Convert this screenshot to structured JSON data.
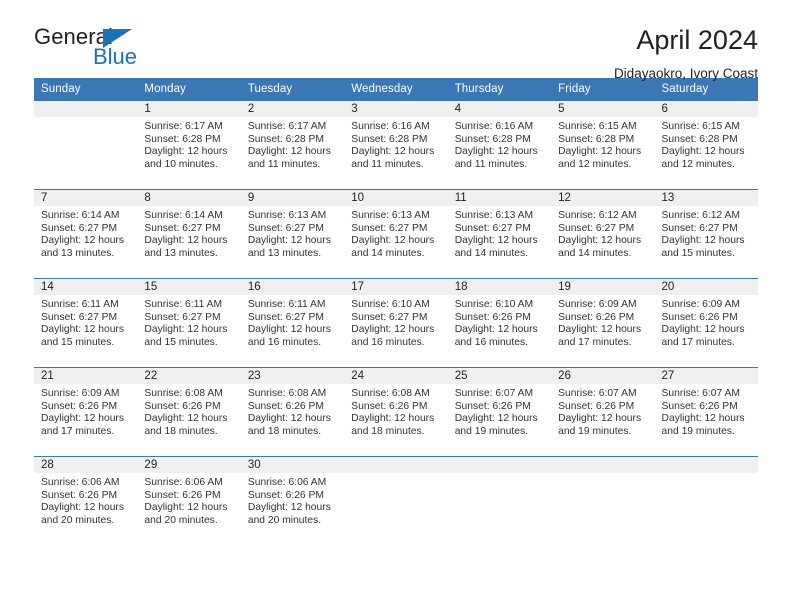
{
  "brand": {
    "name_part1": "General",
    "name_part2": "Blue",
    "accent_color": "#1b72b8"
  },
  "header": {
    "title": "April 2024",
    "location": "Didayaokro, Ivory Coast"
  },
  "theme": {
    "header_row_color": "#3b77b5",
    "daynum_band_color": "#f0f0f0",
    "text_color": "#231f20"
  },
  "weekdays": [
    "Sunday",
    "Monday",
    "Tuesday",
    "Wednesday",
    "Thursday",
    "Friday",
    "Saturday"
  ],
  "weeks": [
    [
      {
        "day": "",
        "sunrise": "",
        "sunset": "",
        "daylight_line1": "",
        "daylight_line2": "",
        "empty": true
      },
      {
        "day": "1",
        "sunrise": "Sunrise: 6:17 AM",
        "sunset": "Sunset: 6:28 PM",
        "daylight_line1": "Daylight: 12 hours",
        "daylight_line2": "and 10 minutes."
      },
      {
        "day": "2",
        "sunrise": "Sunrise: 6:17 AM",
        "sunset": "Sunset: 6:28 PM",
        "daylight_line1": "Daylight: 12 hours",
        "daylight_line2": "and 11 minutes."
      },
      {
        "day": "3",
        "sunrise": "Sunrise: 6:16 AM",
        "sunset": "Sunset: 6:28 PM",
        "daylight_line1": "Daylight: 12 hours",
        "daylight_line2": "and 11 minutes."
      },
      {
        "day": "4",
        "sunrise": "Sunrise: 6:16 AM",
        "sunset": "Sunset: 6:28 PM",
        "daylight_line1": "Daylight: 12 hours",
        "daylight_line2": "and 11 minutes."
      },
      {
        "day": "5",
        "sunrise": "Sunrise: 6:15 AM",
        "sunset": "Sunset: 6:28 PM",
        "daylight_line1": "Daylight: 12 hours",
        "daylight_line2": "and 12 minutes."
      },
      {
        "day": "6",
        "sunrise": "Sunrise: 6:15 AM",
        "sunset": "Sunset: 6:28 PM",
        "daylight_line1": "Daylight: 12 hours",
        "daylight_line2": "and 12 minutes."
      }
    ],
    [
      {
        "day": "7",
        "sunrise": "Sunrise: 6:14 AM",
        "sunset": "Sunset: 6:27 PM",
        "daylight_line1": "Daylight: 12 hours",
        "daylight_line2": "and 13 minutes."
      },
      {
        "day": "8",
        "sunrise": "Sunrise: 6:14 AM",
        "sunset": "Sunset: 6:27 PM",
        "daylight_line1": "Daylight: 12 hours",
        "daylight_line2": "and 13 minutes."
      },
      {
        "day": "9",
        "sunrise": "Sunrise: 6:13 AM",
        "sunset": "Sunset: 6:27 PM",
        "daylight_line1": "Daylight: 12 hours",
        "daylight_line2": "and 13 minutes."
      },
      {
        "day": "10",
        "sunrise": "Sunrise: 6:13 AM",
        "sunset": "Sunset: 6:27 PM",
        "daylight_line1": "Daylight: 12 hours",
        "daylight_line2": "and 14 minutes."
      },
      {
        "day": "11",
        "sunrise": "Sunrise: 6:13 AM",
        "sunset": "Sunset: 6:27 PM",
        "daylight_line1": "Daylight: 12 hours",
        "daylight_line2": "and 14 minutes."
      },
      {
        "day": "12",
        "sunrise": "Sunrise: 6:12 AM",
        "sunset": "Sunset: 6:27 PM",
        "daylight_line1": "Daylight: 12 hours",
        "daylight_line2": "and 14 minutes."
      },
      {
        "day": "13",
        "sunrise": "Sunrise: 6:12 AM",
        "sunset": "Sunset: 6:27 PM",
        "daylight_line1": "Daylight: 12 hours",
        "daylight_line2": "and 15 minutes."
      }
    ],
    [
      {
        "day": "14",
        "sunrise": "Sunrise: 6:11 AM",
        "sunset": "Sunset: 6:27 PM",
        "daylight_line1": "Daylight: 12 hours",
        "daylight_line2": "and 15 minutes."
      },
      {
        "day": "15",
        "sunrise": "Sunrise: 6:11 AM",
        "sunset": "Sunset: 6:27 PM",
        "daylight_line1": "Daylight: 12 hours",
        "daylight_line2": "and 15 minutes."
      },
      {
        "day": "16",
        "sunrise": "Sunrise: 6:11 AM",
        "sunset": "Sunset: 6:27 PM",
        "daylight_line1": "Daylight: 12 hours",
        "daylight_line2": "and 16 minutes."
      },
      {
        "day": "17",
        "sunrise": "Sunrise: 6:10 AM",
        "sunset": "Sunset: 6:27 PM",
        "daylight_line1": "Daylight: 12 hours",
        "daylight_line2": "and 16 minutes."
      },
      {
        "day": "18",
        "sunrise": "Sunrise: 6:10 AM",
        "sunset": "Sunset: 6:26 PM",
        "daylight_line1": "Daylight: 12 hours",
        "daylight_line2": "and 16 minutes."
      },
      {
        "day": "19",
        "sunrise": "Sunrise: 6:09 AM",
        "sunset": "Sunset: 6:26 PM",
        "daylight_line1": "Daylight: 12 hours",
        "daylight_line2": "and 17 minutes."
      },
      {
        "day": "20",
        "sunrise": "Sunrise: 6:09 AM",
        "sunset": "Sunset: 6:26 PM",
        "daylight_line1": "Daylight: 12 hours",
        "daylight_line2": "and 17 minutes."
      }
    ],
    [
      {
        "day": "21",
        "sunrise": "Sunrise: 6:09 AM",
        "sunset": "Sunset: 6:26 PM",
        "daylight_line1": "Daylight: 12 hours",
        "daylight_line2": "and 17 minutes."
      },
      {
        "day": "22",
        "sunrise": "Sunrise: 6:08 AM",
        "sunset": "Sunset: 6:26 PM",
        "daylight_line1": "Daylight: 12 hours",
        "daylight_line2": "and 18 minutes."
      },
      {
        "day": "23",
        "sunrise": "Sunrise: 6:08 AM",
        "sunset": "Sunset: 6:26 PM",
        "daylight_line1": "Daylight: 12 hours",
        "daylight_line2": "and 18 minutes."
      },
      {
        "day": "24",
        "sunrise": "Sunrise: 6:08 AM",
        "sunset": "Sunset: 6:26 PM",
        "daylight_line1": "Daylight: 12 hours",
        "daylight_line2": "and 18 minutes."
      },
      {
        "day": "25",
        "sunrise": "Sunrise: 6:07 AM",
        "sunset": "Sunset: 6:26 PM",
        "daylight_line1": "Daylight: 12 hours",
        "daylight_line2": "and 19 minutes."
      },
      {
        "day": "26",
        "sunrise": "Sunrise: 6:07 AM",
        "sunset": "Sunset: 6:26 PM",
        "daylight_line1": "Daylight: 12 hours",
        "daylight_line2": "and 19 minutes."
      },
      {
        "day": "27",
        "sunrise": "Sunrise: 6:07 AM",
        "sunset": "Sunset: 6:26 PM",
        "daylight_line1": "Daylight: 12 hours",
        "daylight_line2": "and 19 minutes."
      }
    ],
    [
      {
        "day": "28",
        "sunrise": "Sunrise: 6:06 AM",
        "sunset": "Sunset: 6:26 PM",
        "daylight_line1": "Daylight: 12 hours",
        "daylight_line2": "and 20 minutes."
      },
      {
        "day": "29",
        "sunrise": "Sunrise: 6:06 AM",
        "sunset": "Sunset: 6:26 PM",
        "daylight_line1": "Daylight: 12 hours",
        "daylight_line2": "and 20 minutes."
      },
      {
        "day": "30",
        "sunrise": "Sunrise: 6:06 AM",
        "sunset": "Sunset: 6:26 PM",
        "daylight_line1": "Daylight: 12 hours",
        "daylight_line2": "and 20 minutes."
      },
      {
        "day": "",
        "sunrise": "",
        "sunset": "",
        "daylight_line1": "",
        "daylight_line2": "",
        "empty": true
      },
      {
        "day": "",
        "sunrise": "",
        "sunset": "",
        "daylight_line1": "",
        "daylight_line2": "",
        "empty": true
      },
      {
        "day": "",
        "sunrise": "",
        "sunset": "",
        "daylight_line1": "",
        "daylight_line2": "",
        "empty": true
      },
      {
        "day": "",
        "sunrise": "",
        "sunset": "",
        "daylight_line1": "",
        "daylight_line2": "",
        "empty": true
      }
    ]
  ]
}
